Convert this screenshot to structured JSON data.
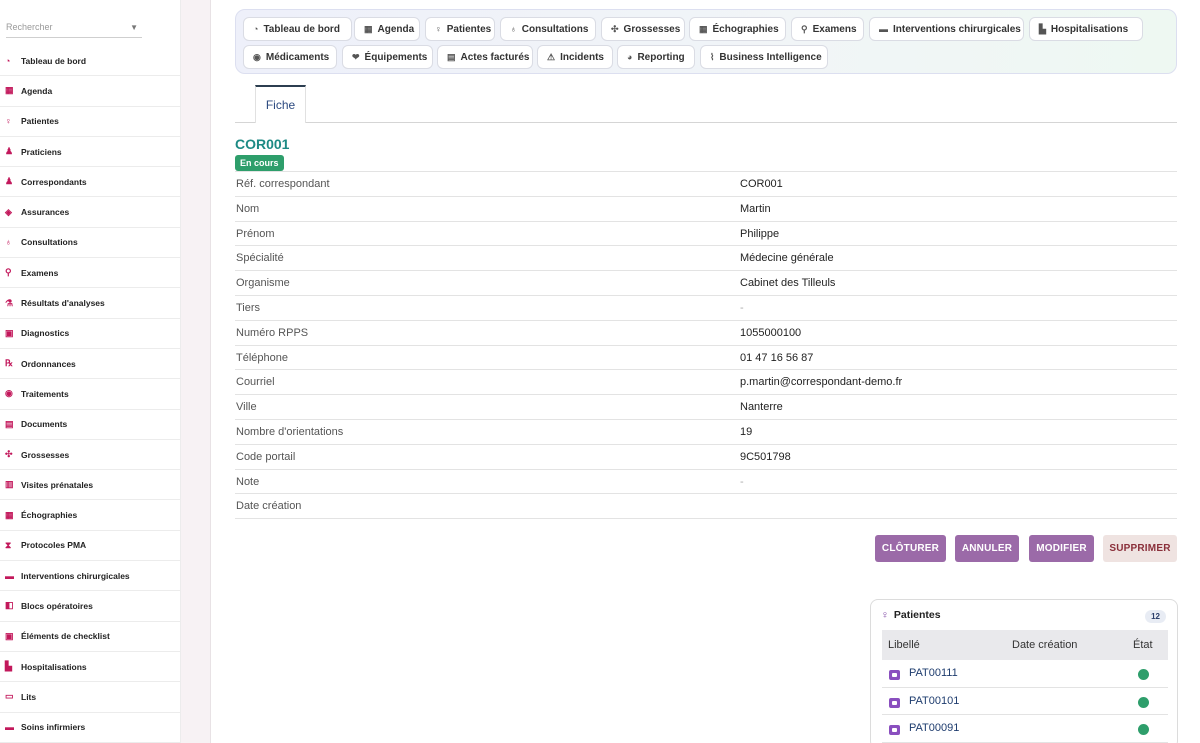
{
  "sidebar": {
    "search_placeholder": "Rechercher",
    "items": [
      {
        "label": "Tableau de bord",
        "icon": "dashboard-icon"
      },
      {
        "label": "Agenda",
        "icon": "calendar-icon"
      },
      {
        "label": "Patientes",
        "icon": "female-icon"
      },
      {
        "label": "Praticiens",
        "icon": "doctor-icon"
      },
      {
        "label": "Correspondants",
        "icon": "contact-icon"
      },
      {
        "label": "Assurances",
        "icon": "shield-icon"
      },
      {
        "label": "Consultations",
        "icon": "stethoscope-icon"
      },
      {
        "label": "Examens",
        "icon": "exam-icon"
      },
      {
        "label": "Résultats d'analyses",
        "icon": "lab-icon"
      },
      {
        "label": "Diagnostics",
        "icon": "diagnosis-icon"
      },
      {
        "label": "Ordonnances",
        "icon": "prescription-icon"
      },
      {
        "label": "Traitements",
        "icon": "pills-icon"
      },
      {
        "label": "Documents",
        "icon": "document-icon"
      },
      {
        "label": "Grossesses",
        "icon": "pregnancy-icon"
      },
      {
        "label": "Visites prénatales",
        "icon": "clipboard-icon"
      },
      {
        "label": "Échographies",
        "icon": "ultrasound-icon"
      },
      {
        "label": "Protocoles PMA",
        "icon": "hourglass-icon"
      },
      {
        "label": "Interventions chirurgicales",
        "icon": "surgery-icon"
      },
      {
        "label": "Blocs opératoires",
        "icon": "operating-room-icon"
      },
      {
        "label": "Éléments de checklist",
        "icon": "checklist-icon"
      },
      {
        "label": "Hospitalisations",
        "icon": "hospital-icon"
      },
      {
        "label": "Lits",
        "icon": "bed-icon"
      },
      {
        "label": "Soins infirmiers",
        "icon": "nursing-icon"
      }
    ]
  },
  "modules": {
    "row1": [
      {
        "label": "Tableau de bord",
        "icon": "dashboard-icon"
      },
      {
        "label": "Agenda",
        "icon": "calendar-icon"
      },
      {
        "label": "Patientes",
        "icon": "female-icon"
      },
      {
        "label": "Consultations",
        "icon": "stethoscope-icon"
      },
      {
        "label": "Grossesses",
        "icon": "pregnancy-icon"
      },
      {
        "label": "Échographies",
        "icon": "ultrasound-icon"
      },
      {
        "label": "Examens",
        "icon": "exam-icon"
      },
      {
        "label": "Interventions chirurgicales",
        "icon": "surgery-icon"
      },
      {
        "label": "Hospitalisations",
        "icon": "hospital-icon"
      }
    ],
    "row2": [
      {
        "label": "Médicaments",
        "icon": "pills-icon"
      },
      {
        "label": "Équipements",
        "icon": "equipment-icon"
      },
      {
        "label": "Actes facturés",
        "icon": "invoice-icon"
      },
      {
        "label": "Incidents",
        "icon": "warning-icon"
      },
      {
        "label": "Reporting",
        "icon": "pie-chart-icon"
      },
      {
        "label": "Business Intelligence",
        "icon": "line-chart-icon"
      }
    ]
  },
  "tabs": {
    "fiche": "Fiche"
  },
  "record": {
    "title": "COR001",
    "status": "En cours",
    "fields": [
      {
        "label": "Réf. correspondant",
        "value": "COR001"
      },
      {
        "label": "Nom",
        "value": "Martin"
      },
      {
        "label": "Prénom",
        "value": "Philippe"
      },
      {
        "label": "Spécialité",
        "value": "Médecine générale"
      },
      {
        "label": "Organisme",
        "value": "Cabinet des Tilleuls"
      },
      {
        "label": "Tiers",
        "value": "-"
      },
      {
        "label": "Numéro RPPS",
        "value": "1055000100"
      },
      {
        "label": "Téléphone",
        "value": "01 47 16 56 87"
      },
      {
        "label": "Courriel",
        "value": "p.martin@correspondant-demo.fr"
      },
      {
        "label": "Ville",
        "value": "Nanterre"
      },
      {
        "label": "Nombre d'orientations",
        "value": "19"
      },
      {
        "label": "Code portail",
        "value": "9C501798"
      },
      {
        "label": "Note",
        "value": "-"
      },
      {
        "label": "Date création",
        "value": ""
      }
    ]
  },
  "actions": {
    "close": "CLÔTURER",
    "cancel": "ANNULER",
    "edit": "MODIFIER",
    "delete": "SUPPRIMER"
  },
  "patients_panel": {
    "title": "Patientes",
    "count": "12",
    "columns": [
      "Libellé",
      "Date création",
      "État"
    ],
    "rows": [
      {
        "label": "PAT00111",
        "date": "",
        "status": "green"
      },
      {
        "label": "PAT00101",
        "date": "",
        "status": "green"
      },
      {
        "label": "PAT00091",
        "date": "",
        "status": "green"
      }
    ]
  },
  "colors": {
    "accent": "#9b6aa8",
    "title": "#1d8a84",
    "status_ok": "#2e9e6b",
    "sidebar_icon": "#c2185b"
  }
}
